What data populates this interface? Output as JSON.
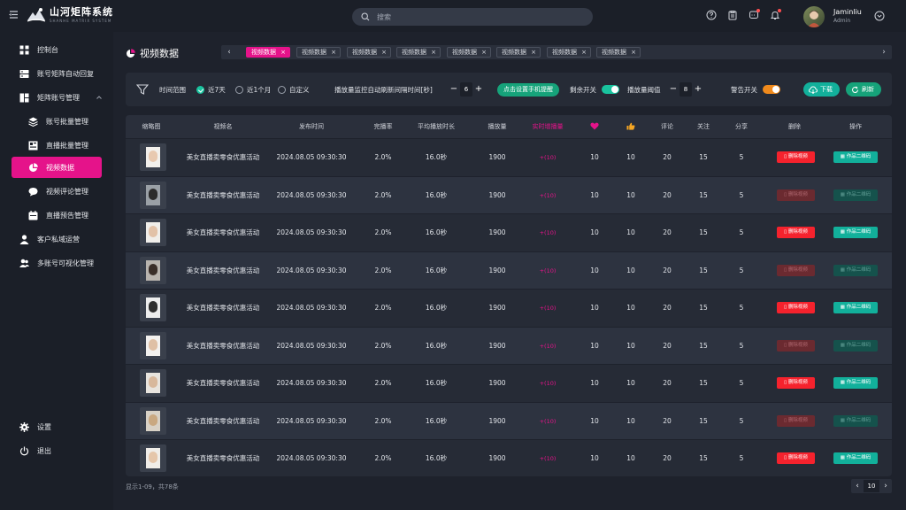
{
  "app": {
    "title": "山河矩阵系统",
    "subtitle": "SHANHE MATRIX SYSTEM"
  },
  "search": {
    "placeholder": "搜索"
  },
  "user": {
    "name": "Jaminliu",
    "role": "Admin"
  },
  "sidebar": {
    "items": [
      {
        "label": "控制台",
        "icon": "dashboard-icon"
      },
      {
        "label": "账号矩阵自动回复",
        "icon": "reply-icon"
      },
      {
        "label": "矩阵账号管理",
        "icon": "accounts-icon",
        "expanded": true
      },
      {
        "label": "账号批量管理",
        "icon": "layers-icon"
      },
      {
        "label": "直播批量管理",
        "icon": "live-icon"
      },
      {
        "label": "视频数据",
        "icon": "pie-icon",
        "active": true
      },
      {
        "label": "视频评论管理",
        "icon": "comment-icon"
      },
      {
        "label": "直播预告管理",
        "icon": "calendar-icon"
      },
      {
        "label": "客户私域运营",
        "icon": "user-icon"
      },
      {
        "label": "多账号可视化管理",
        "icon": "users-icon"
      }
    ],
    "settings": "设置",
    "logout": "退出"
  },
  "page": {
    "title": "视频数据"
  },
  "tabs": [
    "视频数据",
    "视频数据",
    "视频数据",
    "视频数据",
    "视频数据",
    "视频数据",
    "视频数据",
    "视频数据"
  ],
  "filters": {
    "time_label": "时间范围",
    "options": [
      "近7天",
      "近1个月",
      "自定义"
    ],
    "selected": "近7天",
    "refresh_label": "播放量监控自动刷新间隔时间[秒]",
    "refresh_value": "6",
    "phone_alert": "点击设置手机提醒",
    "remain_label": "剩余开关",
    "threshold_label": "播放量阈值",
    "threshold_value": "8",
    "warn_label": "警告开关",
    "download": "下载",
    "refresh": "刷新"
  },
  "table": {
    "headers": [
      "缩略图",
      "视频名",
      "发布时间",
      "完播率",
      "平均播放时长",
      "播放量",
      "实时增播量",
      "",
      "",
      "评论",
      "关注",
      "分享",
      "删除",
      "操作"
    ],
    "rows": [
      {
        "name": "美女直播卖零食优惠活动",
        "time": "2024.08.05  09:30:30",
        "rate": "2.0%",
        "avg": "16.0秒",
        "plays": "1900",
        "growth": "+(10)",
        "hearts": "10",
        "likes": "10",
        "comments": "20",
        "follows": "15",
        "shares": "5",
        "del": "删除视频",
        "op": "作品二维码",
        "enabled": true
      },
      {
        "name": "美女直播卖零食优惠活动",
        "time": "2024.08.05  09:30:30",
        "rate": "2.0%",
        "avg": "16.0秒",
        "plays": "1900",
        "growth": "+(10)",
        "hearts": "10",
        "likes": "10",
        "comments": "20",
        "follows": "15",
        "shares": "5",
        "del": "删除视频",
        "op": "作品二维码",
        "enabled": false
      },
      {
        "name": "美女直播卖零食优惠活动",
        "time": "2024.08.05  09:30:30",
        "rate": "2.0%",
        "avg": "16.0秒",
        "plays": "1900",
        "growth": "+(10)",
        "hearts": "10",
        "likes": "10",
        "comments": "20",
        "follows": "15",
        "shares": "5",
        "del": "删除视频",
        "op": "作品二维码",
        "enabled": true
      },
      {
        "name": "美女直播卖零食优惠活动",
        "time": "2024.08.05  09:30:30",
        "rate": "2.0%",
        "avg": "16.0秒",
        "plays": "1900",
        "growth": "+(10)",
        "hearts": "10",
        "likes": "10",
        "comments": "20",
        "follows": "15",
        "shares": "5",
        "del": "删除视频",
        "op": "作品二维码",
        "enabled": false
      },
      {
        "name": "美女直播卖零食优惠活动",
        "time": "2024.08.05  09:30:30",
        "rate": "2.0%",
        "avg": "16.0秒",
        "plays": "1900",
        "growth": "+(10)",
        "hearts": "10",
        "likes": "10",
        "comments": "20",
        "follows": "15",
        "shares": "5",
        "del": "删除视频",
        "op": "作品二维码",
        "enabled": true
      },
      {
        "name": "美女直播卖零食优惠活动",
        "time": "2024.08.05  09:30:30",
        "rate": "2.0%",
        "avg": "16.0秒",
        "plays": "1900",
        "growth": "+(10)",
        "hearts": "10",
        "likes": "10",
        "comments": "20",
        "follows": "15",
        "shares": "5",
        "del": "删除视频",
        "op": "作品二维码",
        "enabled": false
      },
      {
        "name": "美女直播卖零食优惠活动",
        "time": "2024.08.05  09:30:30",
        "rate": "2.0%",
        "avg": "16.0秒",
        "plays": "1900",
        "growth": "+(10)",
        "hearts": "10",
        "likes": "10",
        "comments": "20",
        "follows": "15",
        "shares": "5",
        "del": "删除视频",
        "op": "作品二维码",
        "enabled": true
      },
      {
        "name": "美女直播卖零食优惠活动",
        "time": "2024.08.05  09:30:30",
        "rate": "2.0%",
        "avg": "16.0秒",
        "plays": "1900",
        "growth": "+(10)",
        "hearts": "10",
        "likes": "10",
        "comments": "20",
        "follows": "15",
        "shares": "5",
        "del": "删除视频",
        "op": "作品二维码",
        "enabled": false
      },
      {
        "name": "美女直播卖零食优惠活动",
        "time": "2024.08.05  09:30:30",
        "rate": "2.0%",
        "avg": "16.0秒",
        "plays": "1900",
        "growth": "+(10)",
        "hearts": "10",
        "likes": "10",
        "comments": "20",
        "follows": "15",
        "shares": "5",
        "del": "删除视频",
        "op": "作品二维码",
        "enabled": true
      }
    ]
  },
  "pager": {
    "info": "显示1-09，共78条",
    "size": "10"
  },
  "colors": {
    "accent": "#e5138a",
    "green": "#12b09b",
    "danger": "#f5222d",
    "warning": "#f08a1c"
  }
}
